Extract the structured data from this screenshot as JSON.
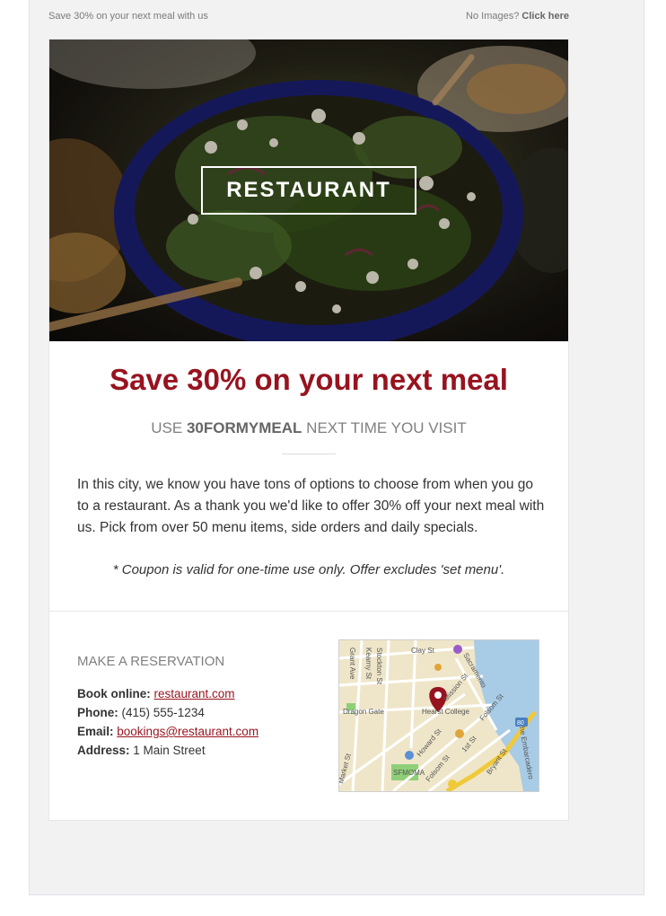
{
  "preheader": {
    "left_text": "Save 30% on your next meal with us",
    "right_text": "No Images?",
    "right_link": "Click here"
  },
  "hero": {
    "logo_text": "RESTAURANT"
  },
  "offer": {
    "headline": "Save 30% on your next meal",
    "sub_prefix": "USE ",
    "code": "30FORMYMEAL",
    "sub_suffix": " NEXT TIME YOU VISIT",
    "body_line1": "In this city, we know you have tons of options to choose from when you go",
    "body_line2": "to a restaurant. As a thank you we'd like to offer 30% off your next meal with",
    "body_line3": "us. Pick from over 50 menu items, side orders and daily specials.",
    "note": "* Coupon is valid for one-time use only. Offer excludes 'set menu'."
  },
  "reservation": {
    "title": "MAKE A RESERVATION",
    "online_label": "Book online:",
    "online_value": "restaurant.com",
    "phone_label": "Phone:",
    "phone_value": "(415) 555-1234",
    "email_label": "Email:",
    "email_value": "bookings@restaurant.com",
    "address_label": "Address:",
    "address_value": "1 Main Street"
  },
  "map": {
    "labels": {
      "clay": "Clay St",
      "sacramento": "Sacramento",
      "kearny": "Kearny St",
      "grant": "Grant Ave",
      "stockton": "Stockton St",
      "dragon_gate": "Dragon Gate",
      "hearst": "Hearst College",
      "mission": "Mission St",
      "folsom_e": "Folsom St",
      "market": "Market St",
      "howard": "Howard St",
      "first": "1st St",
      "somoma": "SFMOMA",
      "folsom_s": "Folsom St",
      "bryant": "Bryant St",
      "embarcadero": "The Embarcadero",
      "route": "80"
    }
  },
  "colors": {
    "accent": "#97131f",
    "text": "#333333",
    "muted": "#808080"
  }
}
